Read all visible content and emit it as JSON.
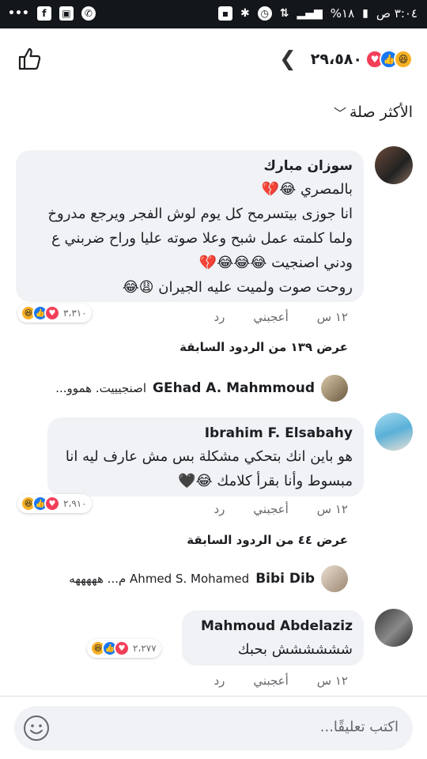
{
  "status_bar": {
    "time": "٣:٠٤ ص",
    "battery": "%١٨"
  },
  "header": {
    "reaction_count": "٢٩،٥٨٠"
  },
  "sort": {
    "label": "الأكثر صلة"
  },
  "comments": [
    {
      "author": "سوزان مبارك",
      "text": "بالمصري 😂💔\nانا جوزى بيتسرمح كل يوم لوش الفجر ويرجع مدروخ ولما كلمته عمل شبح وعلا صوته عليا وراح ضربني ع ودني اصنجيت 😂😂😂💔\nروحت صوت ولميت عليه الجيران 😩😂",
      "time": "١٢ س",
      "like": "أعجبني",
      "reply": "رد",
      "reaction_count": "٣،٣١٠",
      "more_replies": "عرض ١٣٩ من الردود السابقة",
      "reply_preview": {
        "name": "GEhad A. Mahmmoud",
        "text": "اصنجيييت. هموو..."
      }
    },
    {
      "author": "Ibrahim F. Elsabahy",
      "text": "هو باين انك بتحكي مشكلة بس مش عارف ليه انا مبسوط وأنا بقرأ كلامك 😂🖤",
      "time": "١٢ س",
      "like": "أعجبني",
      "reply": "رد",
      "reaction_count": "٢،٩١٠",
      "more_replies": "عرض ٤٤ من الردود السابقة",
      "reply_preview": {
        "name": "Bibi Dib",
        "text": "Ahmed S. Mohamed م... هههههه"
      }
    },
    {
      "author": "Mahmoud Abdelaziz",
      "text": "شششششش بحبك",
      "time": "١٢ س",
      "like": "أعجبني",
      "reply": "رد",
      "reaction_count": "٢،٢٧٧"
    }
  ],
  "composer": {
    "placeholder": "اكتب تعليقًا..."
  },
  "colors": {
    "like_blue": "#1877f2",
    "love_red": "#f33e58",
    "haha_yellow": "#f7b125",
    "bubble_gray": "#f0f2f5"
  }
}
